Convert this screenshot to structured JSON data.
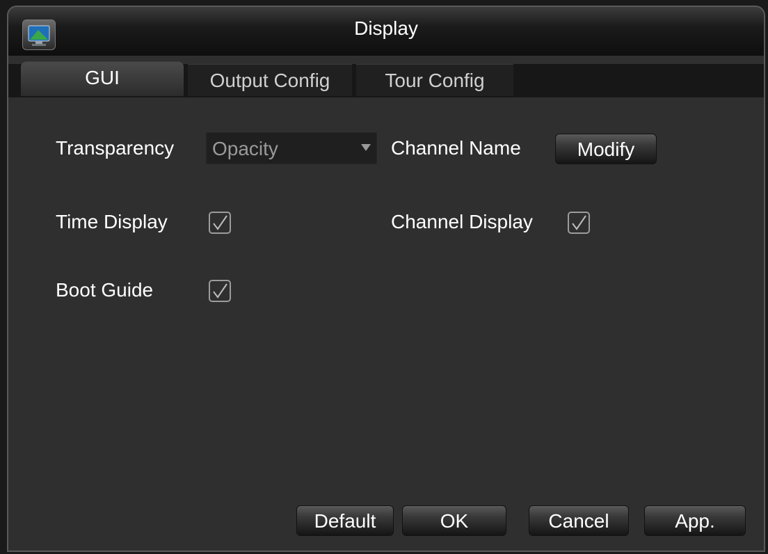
{
  "window": {
    "title": "Display"
  },
  "tabs": [
    {
      "label": "GUI",
      "active": true
    },
    {
      "label": "Output Config",
      "active": false
    },
    {
      "label": "Tour Config",
      "active": false
    }
  ],
  "form": {
    "transparency": {
      "label": "Transparency",
      "value": "Opacity"
    },
    "channel_name": {
      "label": "Channel Name",
      "button_label": "Modify"
    },
    "time_display": {
      "label": "Time Display",
      "checked": true
    },
    "channel_display": {
      "label": "Channel Display",
      "checked": true
    },
    "boot_guide": {
      "label": "Boot Guide",
      "checked": true
    }
  },
  "footer": {
    "default_label": "Default",
    "ok_label": "OK",
    "cancel_label": "Cancel",
    "apply_label": "App."
  },
  "colors": {
    "panel_background": "#2f2f2f",
    "titlebar": "#0e0e0e",
    "text": "#ffffff",
    "select_text": "#9a9a9a",
    "checkbox_border": "#9c9c9c"
  },
  "icons": {
    "app": "monitor-icon",
    "dropdown": "chevron-down-icon",
    "check": "checkmark-icon"
  }
}
